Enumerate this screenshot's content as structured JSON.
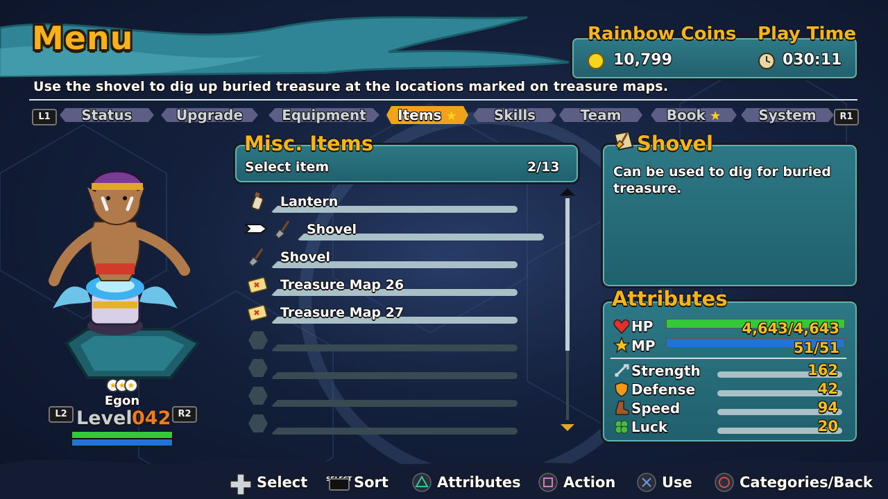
{
  "header": {
    "title": "Menu",
    "description": "Use the shovel to dig up buried treasure at the locations marked on treasure maps.",
    "coins_label": "Rainbow Coins",
    "coins_value": "10,799",
    "playtime_label": "Play Time",
    "playtime_value": "030:11"
  },
  "tabs": {
    "left_shoulder": "L1",
    "right_shoulder": "R1",
    "items": [
      {
        "label": "Status"
      },
      {
        "label": "Upgrade"
      },
      {
        "label": "Equipment"
      },
      {
        "label": "Items",
        "starred": true,
        "active": true
      },
      {
        "label": "Skills"
      },
      {
        "label": "Team"
      },
      {
        "label": "Book",
        "starred": true
      },
      {
        "label": "System"
      }
    ]
  },
  "character": {
    "name": "Egon",
    "level_label": "Level",
    "level_value": "042",
    "left_button": "L2",
    "right_button": "R2"
  },
  "list": {
    "title": "Misc. Items",
    "subtitle": "Select item",
    "count": "2/13",
    "items": [
      {
        "label": "Lantern",
        "icon": "lantern-icon"
      },
      {
        "label": "Shovel",
        "icon": "shovel-icon",
        "selected": true
      },
      {
        "label": "Shovel",
        "icon": "shovel-icon"
      },
      {
        "label": "Treasure Map 26",
        "icon": "treasure-map-icon"
      },
      {
        "label": "Treasure Map 27",
        "icon": "treasure-map-icon"
      },
      {
        "label": ""
      },
      {
        "label": ""
      },
      {
        "label": ""
      },
      {
        "label": ""
      }
    ]
  },
  "detail": {
    "title": "Shovel",
    "description": "Can be used to dig for buried treasure."
  },
  "attributes": {
    "title": "Attributes",
    "hp_label": "HP",
    "hp_value": "4,643/4,643",
    "hp_fraction": 1.0,
    "mp_label": "MP",
    "mp_value": "51/51",
    "mp_fraction": 1.0,
    "stats": [
      {
        "label": "Strength",
        "value": "162",
        "icon": "sword-icon"
      },
      {
        "label": "Defense",
        "value": "42",
        "icon": "shield-icon"
      },
      {
        "label": "Speed",
        "value": "94",
        "icon": "boot-icon"
      },
      {
        "label": "Luck",
        "value": "20",
        "icon": "clover-icon"
      }
    ]
  },
  "controls": {
    "select": "Select",
    "sort_key": "SELECT",
    "sort": "Sort",
    "attributes": "Attributes",
    "action": "Action",
    "use": "Use",
    "back": "Categories/Back"
  },
  "colors": {
    "accent": "#f5b41c",
    "panel": "#2a7280",
    "hp_bar": "#35c93a",
    "mp_bar": "#1f74d6",
    "active_tab": "#f0a21c"
  }
}
